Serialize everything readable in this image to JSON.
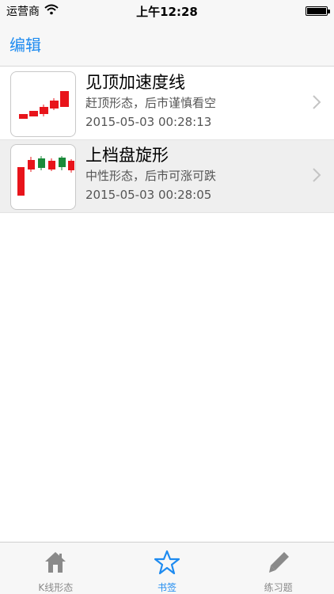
{
  "status_bar": {
    "carrier": "运营商",
    "time": "上午12:28",
    "battery_level": 1.0
  },
  "nav": {
    "edit_label": "编辑"
  },
  "list": [
    {
      "title": "见顶加速度线",
      "subtitle": "赶顶形态，后市谨慎看空",
      "date": "2015-05-03 00:28:13",
      "thumbnail": "rising-red-candles",
      "selected": false
    },
    {
      "title": "上档盘旋形",
      "subtitle": "中性形态，后市可涨可跌",
      "date": "2015-05-03 00:28:05",
      "thumbnail": "consolidation-candles",
      "selected": true
    }
  ],
  "tabs": [
    {
      "label": "K线形态",
      "icon": "house-icon",
      "active": false
    },
    {
      "label": "书签",
      "icon": "star-icon",
      "active": true
    },
    {
      "label": "练习题",
      "icon": "pencil-icon",
      "active": false
    }
  ],
  "colors": {
    "accent": "#1e8bf0",
    "candle_up": "#e8141b",
    "candle_down": "#1a8a3a"
  }
}
